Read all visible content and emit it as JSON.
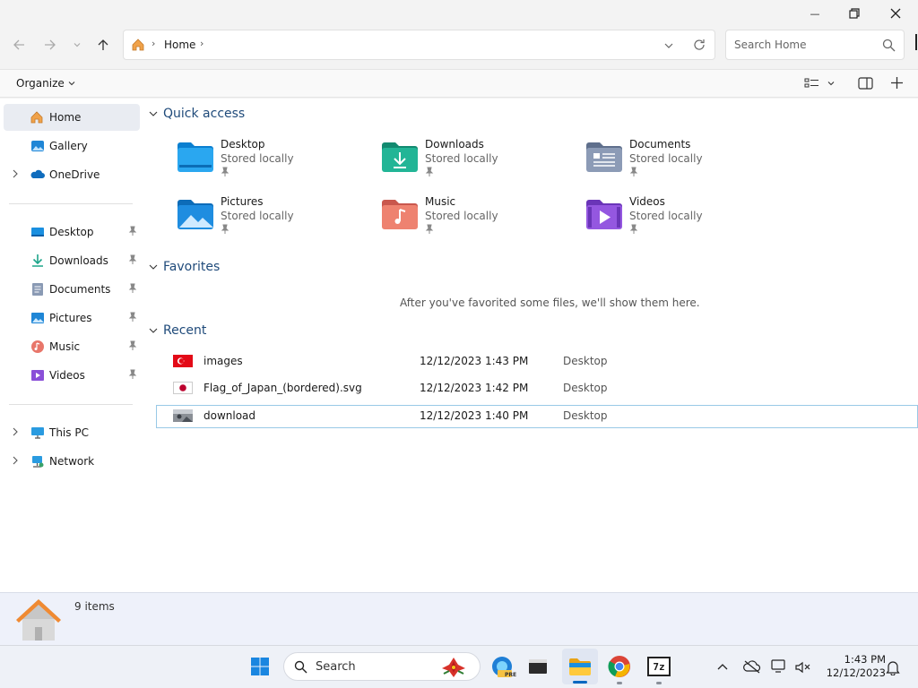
{
  "window": {
    "minimize_glyph": "—",
    "maximize_glyph": "❐",
    "close_glyph": "✕"
  },
  "nav": {
    "breadcrumb": [
      "Home"
    ],
    "search_placeholder": "Search Home"
  },
  "toolbar": {
    "organize_label": "Organize"
  },
  "sidebar": {
    "top": [
      {
        "label": "Home",
        "icon": "home-icon",
        "selected": true
      },
      {
        "label": "Gallery",
        "icon": "gallery-icon"
      },
      {
        "label": "OneDrive",
        "icon": "onedrive-icon",
        "expandable": true
      }
    ],
    "pinned": [
      {
        "label": "Desktop",
        "icon": "desktop-folder-icon"
      },
      {
        "label": "Downloads",
        "icon": "downloads-folder-icon"
      },
      {
        "label": "Documents",
        "icon": "documents-folder-icon"
      },
      {
        "label": "Pictures",
        "icon": "pictures-folder-icon"
      },
      {
        "label": "Music",
        "icon": "music-folder-icon"
      },
      {
        "label": "Videos",
        "icon": "videos-folder-icon"
      }
    ],
    "bottom": [
      {
        "label": "This PC",
        "icon": "pc-icon"
      },
      {
        "label": "Network",
        "icon": "network-icon"
      }
    ]
  },
  "main": {
    "quick_access_title": "Quick access",
    "quick_access": [
      {
        "name": "Desktop",
        "sub": "Stored locally",
        "icon": "desktop-folder-icon",
        "color": "#1a8fe0"
      },
      {
        "name": "Downloads",
        "sub": "Stored locally",
        "icon": "downloads-folder-icon",
        "color": "#1ea58a"
      },
      {
        "name": "Documents",
        "sub": "Stored locally",
        "icon": "documents-folder-icon",
        "color": "#7a8aa6"
      },
      {
        "name": "Pictures",
        "sub": "Stored locally",
        "icon": "pictures-folder-icon",
        "color": "#1f86d6"
      },
      {
        "name": "Music",
        "sub": "Stored locally",
        "icon": "music-folder-icon",
        "color": "#e8766a"
      },
      {
        "name": "Videos",
        "sub": "Stored locally",
        "icon": "videos-folder-icon",
        "color": "#8a4fd8"
      }
    ],
    "favorites_title": "Favorites",
    "favorites_empty": "After you've favorited some files, we'll show them here.",
    "recent_title": "Recent",
    "recent": [
      {
        "name": "images",
        "date": "12/12/2023 1:43 PM",
        "location": "Desktop",
        "thumb": "turkey-flag-thumbnail"
      },
      {
        "name": "Flag_of_Japan_(bordered).svg",
        "date": "12/12/2023 1:42 PM",
        "location": "Desktop",
        "thumb": "japan-flag-thumbnail"
      },
      {
        "name": "download",
        "date": "12/12/2023 1:40 PM",
        "location": "Desktop",
        "thumb": "image-thumbnail",
        "selected": true
      }
    ]
  },
  "status": {
    "count": "9 items"
  },
  "taskbar": {
    "search_label": "Search",
    "time": "1:43 PM",
    "date": "12/12/2023",
    "pre_badge": "PRE",
    "sevenzip_label": "7z"
  },
  "colors": {
    "accent": "#0067c0",
    "section_title": "#1f4a7a",
    "selection_border": "#99c9e6"
  }
}
